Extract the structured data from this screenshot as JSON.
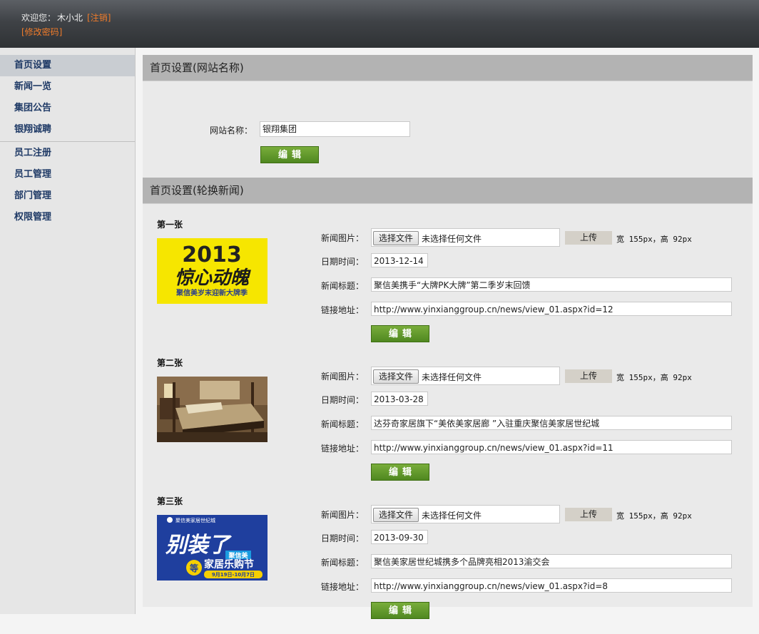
{
  "header": {
    "welcome_label": "欢迎您：",
    "username": "木小北",
    "logout_link": "[注销]",
    "change_password_link": "[修改密码]"
  },
  "sidebar": {
    "items": [
      {
        "label": "首页设置"
      },
      {
        "label": "新闻一览"
      },
      {
        "label": "集团公告"
      },
      {
        "label": "银翔诚聘"
      },
      {
        "label": "员工注册"
      },
      {
        "label": "员工管理"
      },
      {
        "label": "部门管理"
      },
      {
        "label": "权限管理"
      }
    ]
  },
  "site_section": {
    "title": "首页设置(网站名称)",
    "field_label": "网站名称：",
    "site_name": "银翔集团",
    "edit_button": "编辑"
  },
  "carousel_section": {
    "title": "首页设置(轮换新闻)",
    "labels": {
      "image": "新闻图片：",
      "date": "日期时间：",
      "title": "新闻标题：",
      "link": "链接地址："
    },
    "choose_file_button": "选择文件",
    "no_file_text": "未选择任何文件",
    "upload_button": "上传",
    "size_note": "宽 155px，高 92px",
    "edit_button": "编辑",
    "slides": [
      {
        "heading": "第一张",
        "thumb_text": {
          "year": "2013",
          "main": "惊心动魄",
          "sub": "聚信美岁末迎新大牌季"
        },
        "date": "2013-12-14",
        "news_title": "聚信美携手“大牌PK大牌”第二季岁末回馈",
        "link": "http://www.yinxianggroup.cn/news/view_01.aspx?id=12"
      },
      {
        "heading": "第二张",
        "date": "2013-03-28",
        "news_title": "达芬奇家居旗下“美依美家居廊 ”入驻重庆聚信美家居世纪城",
        "link": "http://www.yinxianggroup.cn/news/view_01.aspx?id=11"
      },
      {
        "heading": "第三张",
        "thumb_text": {
          "brand": "聚信美家居世纪城",
          "main": "别装了",
          "tag": "聚信美",
          "fest": "家居乐购节",
          "badge": "等",
          "dates": "9月19日-10月7日"
        },
        "date": "2013-09-30",
        "news_title": "聚信美家居世纪城携多个品牌亮相2013渝交会",
        "link": "http://www.yinxianggroup.cn/news/view_01.aspx?id=8"
      }
    ]
  },
  "colors": {
    "accent_orange": "#ef7b2a",
    "nav_text": "#1f3a66",
    "button_green": "#5b9428",
    "section_header": "#b3b3b3"
  }
}
